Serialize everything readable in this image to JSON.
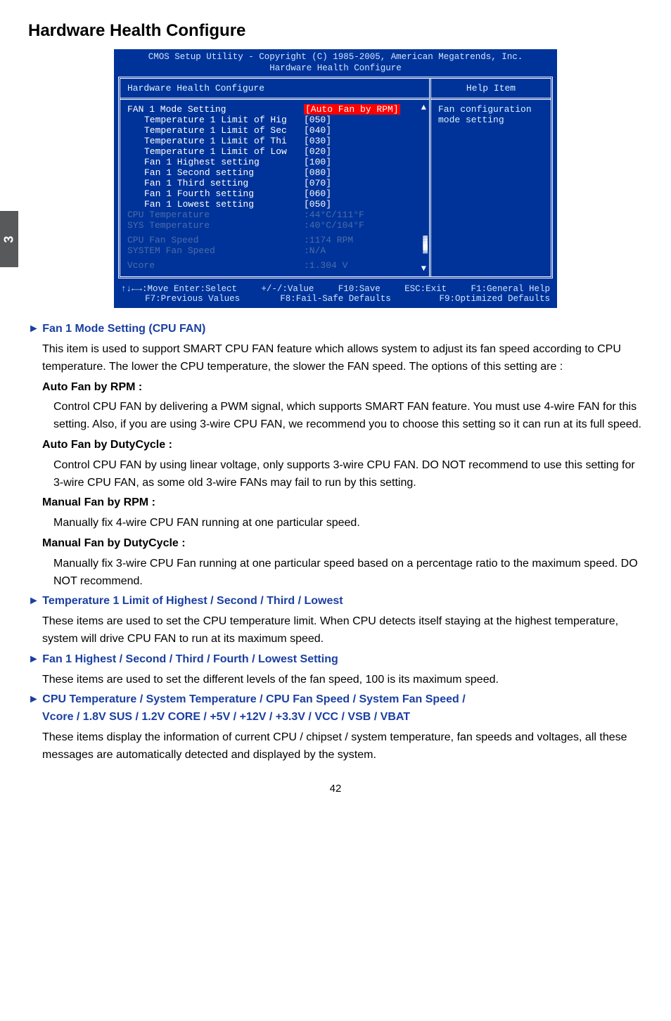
{
  "page": {
    "title": "Hardware Health Configure",
    "sidebar_label": "3",
    "number": "42"
  },
  "bios": {
    "header_top": "CMOS Setup Utility - Copyright (C) 1985-2005, American Megatrends, Inc.",
    "header_sub": "Hardware Health Configure",
    "left_title": "Hardware Health Configure",
    "right_title": "Help Item",
    "help_text_1": "Fan configuration",
    "help_text_2": "mode setting",
    "rows": {
      "r0_label": "FAN 1 Mode Setting",
      "r0_val": "[Auto Fan by RPM]",
      "r1_label": "Temperature 1 Limit of Hig",
      "r1_val": "[050]",
      "r2_label": "Temperature 1 Limit of Sec",
      "r2_val": "[040]",
      "r3_label": "Temperature 1 Limit of Thi",
      "r3_val": "[030]",
      "r4_label": "Temperature 1 Limit of Low",
      "r4_val": "[020]",
      "r5_label": "Fan 1 Highest setting",
      "r5_val": "[100]",
      "r6_label": "Fan 1 Second setting",
      "r6_val": "[080]",
      "r7_label": "Fan 1 Third setting",
      "r7_val": "[070]",
      "r8_label": "Fan 1 Fourth setting",
      "r8_val": "[060]",
      "r9_label": "Fan 1 Lowest setting",
      "r9_val": "[050]",
      "r10_label": "CPU Temperature",
      "r10_val": ":44°C/111°F",
      "r11_label": "SYS Temperature",
      "r11_val": ":40°C/104°F",
      "r12_label": "CPU Fan Speed",
      "r12_val": ":1174 RPM",
      "r13_label": "SYSTEM Fan Speed",
      "r13_val": ":N/A",
      "r14_label": "Vcore",
      "r14_val": ":1.304 V"
    },
    "footer": {
      "l1c1": "↑↓←→:Move   Enter:Select",
      "l1c2": "+/-/:Value",
      "l1c3": "F10:Save",
      "l1c4": "ESC:Exit",
      "l1c5": "F1:General Help",
      "l2c1": "F7:Previous Values",
      "l2c2": "F8:Fail-Safe Defaults",
      "l2c3": "F9:Optimized Defaults"
    },
    "scroll_up": "▲",
    "scroll_down": "▼",
    "scroll_thumb": "▓"
  },
  "desc": {
    "h1": "► Fan 1 Mode Setting (CPU FAN)",
    "h1_p": "This item is used to support SMART CPU FAN feature which allows system to adjust its fan speed according to CPU temperature. The lower the CPU temperature, the slower the FAN speed. The options of this setting are :",
    "h1a": "Auto Fan by RPM :",
    "h1a_p": "Control CPU FAN by delivering a PWM signal, which supports SMART FAN feature. You must use 4-wire FAN for this setting. Also, if you are using 3-wire CPU FAN, we recommend you to choose this setting so it can run at its full speed.",
    "h1b": "Auto Fan by DutyCycle :",
    "h1b_p": "Control CPU FAN by using linear voltage, only supports 3-wire CPU FAN. DO NOT recommend to use this setting for 3-wire CPU FAN, as some old 3-wire FANs may fail to run by this setting.",
    "h1c": "Manual Fan by RPM :",
    "h1c_p": "Manually fix 4-wire CPU FAN running at one particular speed.",
    "h1d": "Manual Fan by DutyCycle :",
    "h1d_p": "Manually fix 3-wire CPU Fan running at one particular speed based on a percentage ratio to the maximum speed. DO NOT recommend.",
    "h2": "► Temperature 1 Limit of Highest / Second / Third / Lowest",
    "h2_p": "These items are used to set the CPU temperature limit. When CPU detects itself staying at the highest temperature, system will drive CPU FAN to run at its maximum speed.",
    "h3": "► Fan 1 Highest / Second / Third / Fourth / Lowest Setting",
    "h3_p": "These items are used to set the different levels of the fan speed, 100 is its maximum speed.",
    "h4a": "► CPU Temperature / System Temperature / CPU Fan Speed / System Fan Speed /",
    "h4b": "Vcore / 1.8V SUS / 1.2V CORE / +5V / +12V / +3.3V / VCC / VSB / VBAT",
    "h4_p": "These items display the information of current CPU / chipset / system temperature, fan speeds and voltages, all these messages are automatically detected and displayed by the system."
  }
}
